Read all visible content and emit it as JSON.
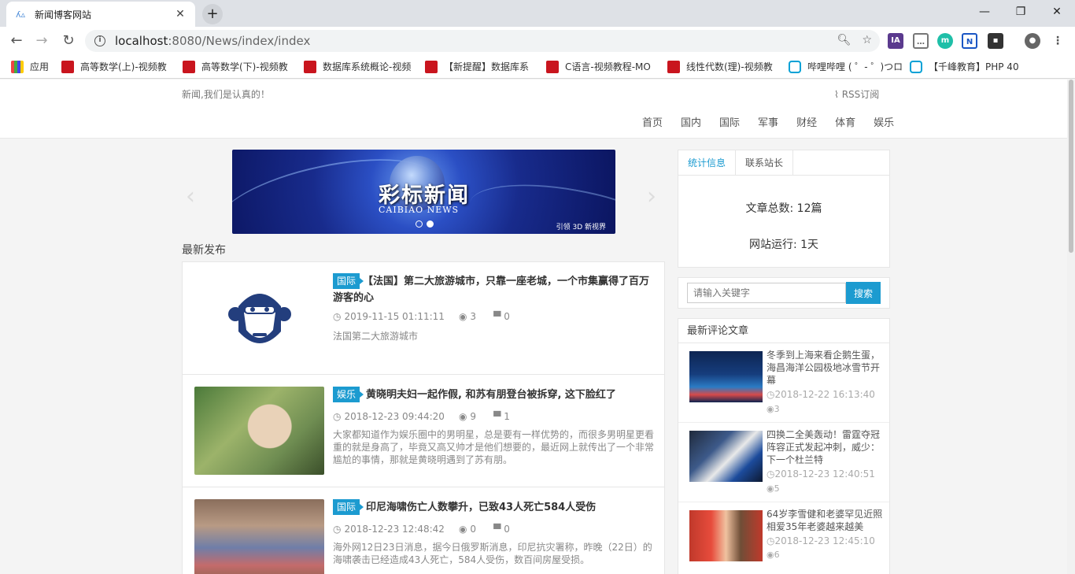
{
  "browser": {
    "tab_title": "新闻博客网站",
    "tab_close": "✕",
    "new_tab": "+",
    "url_host": "localhost",
    "url_rest": ":8080/News/index/index",
    "bookmarks": [
      {
        "label": "应用",
        "icon": "apps-grid-icon"
      },
      {
        "label": "高等数学(上)-视频教",
        "icon": "red-bookmark-icon"
      },
      {
        "label": "高等数学(下)-视频教",
        "icon": "red-bookmark-icon"
      },
      {
        "label": "数据库系统概论-视频",
        "icon": "red-bookmark-icon"
      },
      {
        "label": "【新提醒】数据库系",
        "icon": "red-bookmark-icon"
      },
      {
        "label": "C语言-视频教程-MO",
        "icon": "red-bookmark-icon"
      },
      {
        "label": "线性代数(理)-视频教",
        "icon": "red-bookmark-icon"
      },
      {
        "label": "哔哩哔哩 ( ゜- ゜)つロ",
        "icon": "bilibili-icon"
      },
      {
        "label": "【千峰教育】PHP 40",
        "icon": "bilibili-icon"
      }
    ]
  },
  "header": {
    "slogan": "新闻,我们是认真的！",
    "rss": "RSS订阅",
    "nav": [
      "首页",
      "国内",
      "国际",
      "军事",
      "财经",
      "体育",
      "娱乐"
    ]
  },
  "slider": {
    "title_cn": "彩标新闻",
    "title_en": "CAIBIAO NEWS",
    "corner_text": "引领 3D 新视界",
    "slide_count": 2,
    "active_slide": 2
  },
  "latest_title": "最新发布",
  "articles": [
    {
      "category": "国际",
      "title": "【法国】第二大旅游城市，只靠一座老城，一个市集赢得了百万游客的心",
      "date": "2019-11-15 01:11:11",
      "views": "3",
      "comments": "0",
      "summary": "法国第二大旅游城市",
      "thumb": "monkey-logo"
    },
    {
      "category": "娱乐",
      "title": "黄晓明夫妇一起作假, 和苏有朋登台被拆穿, 这下脸红了",
      "date": "2018-12-23 09:44:20",
      "views": "9",
      "comments": "1",
      "summary": "大家都知道作为娱乐圈中的男明星，总是要有一样优势的，而很多男明星更看重的就是身高了，毕竟又高又帅才是他们想要的，最近网上就传出了一个非常尴尬的事情，那就是黄晓明遇到了苏有朋。",
      "thumb": "photo"
    },
    {
      "category": "国际",
      "title": "印尼海啸伤亡人数攀升，已致43人死亡584人受伤",
      "date": "2018-12-23 12:48:42",
      "views": "0",
      "comments": "0",
      "summary": "海外网12日23日消息，据今日俄罗斯消息，印尼抗灾署称，昨晚（22日）的海啸袭击已经造成43人死亡，584人受伤，数百间房屋受损。",
      "thumb": "photo"
    }
  ],
  "sidebar": {
    "tabs": [
      "统计信息",
      "联系站长"
    ],
    "stats": {
      "article_total": "文章总数: 12篇",
      "site_running": "网站运行: 1天"
    },
    "search": {
      "placeholder": "请输入关键字",
      "button": "搜索"
    },
    "comments_title": "最新评论文章",
    "comment_articles": [
      {
        "title": "冬季到上海来看企鹅生蛋，海昌海洋公园极地冰雪节开幕",
        "date": "2018-12-22 16:13:40",
        "views": "3"
      },
      {
        "title": "四换二全美轰动！雷霆夺冠阵容正式发起冲刺，威少：下一个杜兰特",
        "date": "2018-12-23 12:40:51",
        "views": "5"
      },
      {
        "title": "64岁李雪健和老婆罕见近照 相爱35年老婆越来越美",
        "date": "2018-12-23 12:45:10",
        "views": "6"
      }
    ]
  },
  "colors": {
    "accent": "#1c9bd0",
    "tab_active": "#1c9bd0"
  }
}
